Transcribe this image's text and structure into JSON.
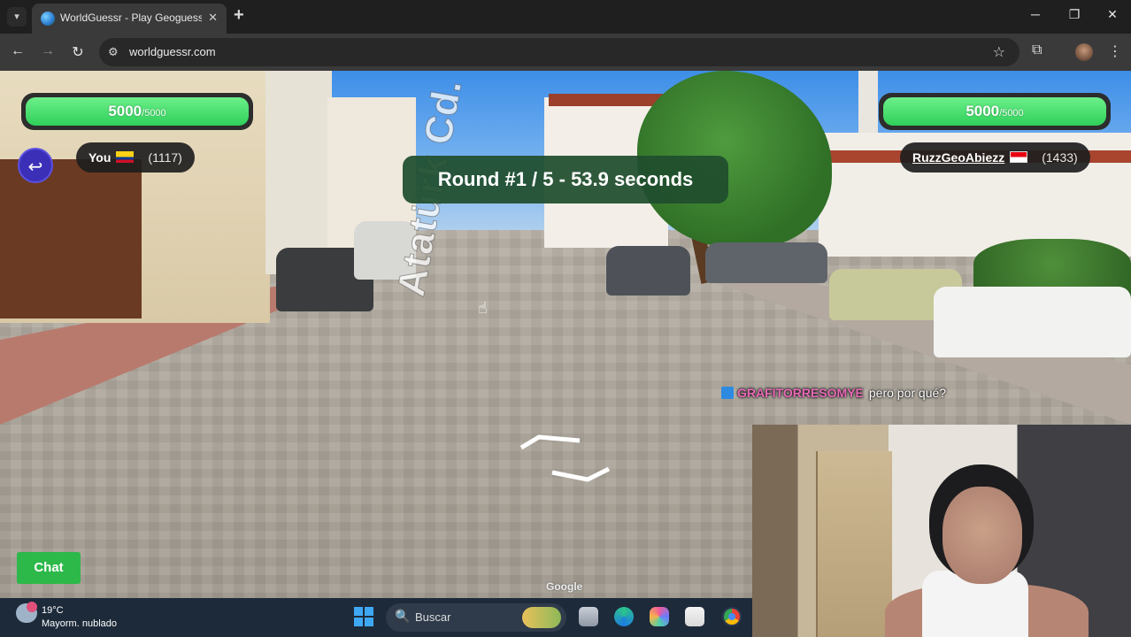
{
  "browser": {
    "tab_list_icon": "chevron-down",
    "tab_title": "WorldGuessr - Play Geoguessr Free",
    "tab_close": "✕",
    "new_tab": "+",
    "minimize": "─",
    "restore": "❐",
    "close": "✕",
    "back": "←",
    "forward": "→",
    "reload": "↻",
    "site_info": "⚙",
    "url": "worldguessr.com",
    "bookmark": "☆",
    "extensions": "⧉",
    "menu": "⋮"
  },
  "game": {
    "left_player": {
      "health": "5000",
      "health_max": "/5000",
      "health_fraction": 1.0,
      "name": "You",
      "flag": "colombia",
      "elo": "(1117)"
    },
    "right_player": {
      "health": "5000",
      "health_max": "/5000",
      "health_fraction": 1.0,
      "name": "RuzzGeoAbiezz",
      "flag": "indonesia",
      "elo": "(1433)"
    },
    "round_banner": "Round #1 / 5 - 53.9 seconds",
    "back_icon": "↩",
    "chat_button": "Chat",
    "chat_message": {
      "sender": "GRAFITORRESOMYE",
      "text": "pero por qué?"
    }
  },
  "streetview": {
    "street_label": "Atatürk Cd.",
    "attribution": "Google"
  },
  "taskbar": {
    "temperature": "19°C",
    "weather": "Mayorm. nublado",
    "search_icon": "🔍",
    "search_placeholder": "Buscar"
  },
  "colors": {
    "health_green": "#2fd05a",
    "banner_green": "#1f4e2d",
    "back_button": "#3b2fb8",
    "chat_button": "#2db84a"
  }
}
